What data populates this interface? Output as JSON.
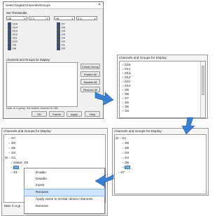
{
  "dialog": {
    "title": "Select Digital Channels/Groups",
    "section_label": "Set Thresholds",
    "dropdowns": [
      {
        "value": "Off"
      },
      {
        "value": "3 V"
      },
      {
        "value": "Off"
      },
      {
        "value": "3 V"
      }
    ],
    "col1_channels": [
      "D15",
      "D14",
      "D13",
      "D12",
      "D11",
      "D10",
      "D9",
      "D8"
    ],
    "col2_channels": [
      "D7",
      "D6",
      "D5",
      "D4",
      "D3",
      "D2",
      "D1",
      "D0"
    ],
    "groups_label": "Channels and Groups for Display:",
    "buttons": {
      "create_group": "Create Group",
      "enable_all": "Enable All",
      "disable_all": "Disable All",
      "remove_all": "Remove All"
    },
    "note": "Note: In a group, the bottom channel is LSB",
    "footer": {
      "ok": "OK",
      "cancel": "Cancel",
      "apply": "Apply",
      "help": "Help"
    }
  },
  "panel_list": {
    "header": "Channels and Groups for Display:",
    "items": [
      "D15",
      "D14",
      "D13",
      "D12",
      "D11",
      "D10",
      "D9",
      "D8",
      "D7",
      "D6",
      "D5",
      "D4"
    ]
  },
  "panel_tree": {
    "header": "Channels and Groups for Display:",
    "group_label": "G1",
    "group_children": [
      "D8",
      "D9",
      "D3",
      "D4",
      "D5",
      "D6"
    ],
    "tail_items": [
      "D7"
    ]
  },
  "panel_context": {
    "header": "Channels and Groups for Display:",
    "top_items": [
      "D7",
      "D6",
      "D5",
      "D4"
    ],
    "group_label": "G1",
    "child_label": "Data3 : D3",
    "selected_child": "D2",
    "next_child": "D1",
    "note": "Note: In a gr",
    "menu": [
      "Enable",
      "Disable",
      "Invert",
      "Rename",
      "Apply name to similar device channels",
      "Remove"
    ],
    "highlighted_item": "Rename"
  },
  "colors": {
    "arrow": "#3b7fd4",
    "selection": "#3b74c9",
    "device_icon": "#2c4f8f",
    "group_icon": "#b23b3b"
  }
}
